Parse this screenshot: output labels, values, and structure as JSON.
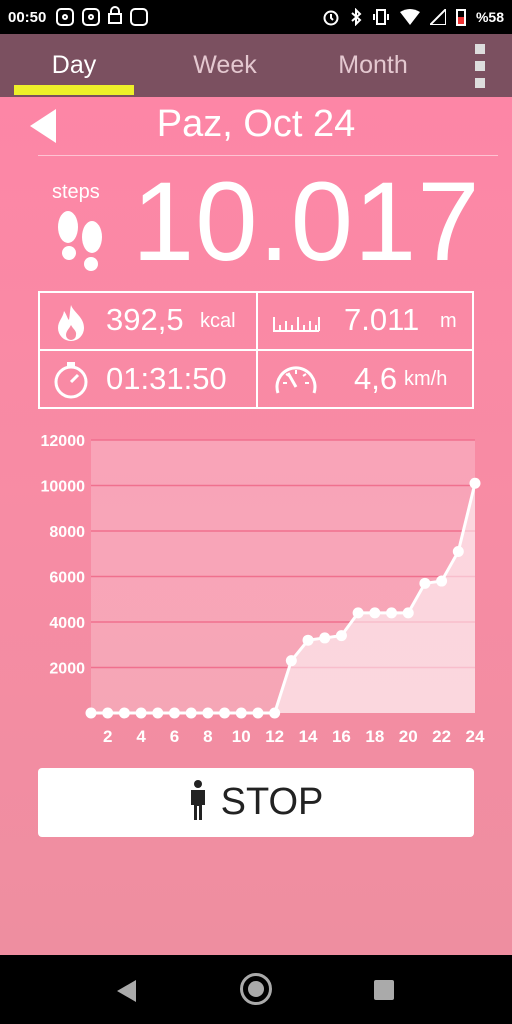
{
  "status_bar": {
    "time": "00:50",
    "battery_text": "%58",
    "icons": [
      "instagram-icon",
      "instagram-icon",
      "lock-icon",
      "wallet-icon",
      "alarm-icon",
      "bluetooth-icon",
      "vibrate-icon",
      "wifi-icon",
      "no-signal-icon",
      "battery-icon"
    ]
  },
  "tabs": [
    {
      "label": "Day",
      "active": true
    },
    {
      "label": "Week",
      "active": false
    },
    {
      "label": "Month",
      "active": false
    }
  ],
  "date_title": "Paz, Oct 24",
  "steps": {
    "label": "steps",
    "value": "10.017"
  },
  "stats": {
    "calories": {
      "value": "392,5",
      "unit": "kcal"
    },
    "distance": {
      "value": "7.011",
      "unit": "m"
    },
    "duration": {
      "value": "01:31:50"
    },
    "speed": {
      "value": "4,6",
      "unit": "km/h"
    }
  },
  "stop_button": {
    "label": "STOP"
  },
  "colors": {
    "accent": "#eef02a",
    "header": "#7b5060",
    "background": "#f78ca4"
  },
  "chart_data": {
    "type": "area",
    "x": [
      1,
      2,
      3,
      4,
      5,
      6,
      7,
      8,
      9,
      10,
      11,
      12,
      13,
      14,
      15,
      16,
      17,
      18,
      19,
      20,
      21,
      22,
      23,
      24
    ],
    "values": [
      0,
      0,
      0,
      0,
      0,
      0,
      0,
      0,
      0,
      0,
      0,
      0,
      2300,
      3200,
      3300,
      3400,
      4400,
      4400,
      4400,
      4400,
      5700,
      5800,
      7100,
      10100
    ],
    "x_ticks": [
      "2",
      "4",
      "6",
      "8",
      "10",
      "12",
      "14",
      "16",
      "18",
      "20",
      "22",
      "24"
    ],
    "y_ticks": [
      "2000",
      "4000",
      "6000",
      "8000",
      "10000",
      "12000"
    ],
    "ylim": [
      0,
      12000
    ],
    "xlim": [
      1,
      24
    ],
    "grid": true
  }
}
